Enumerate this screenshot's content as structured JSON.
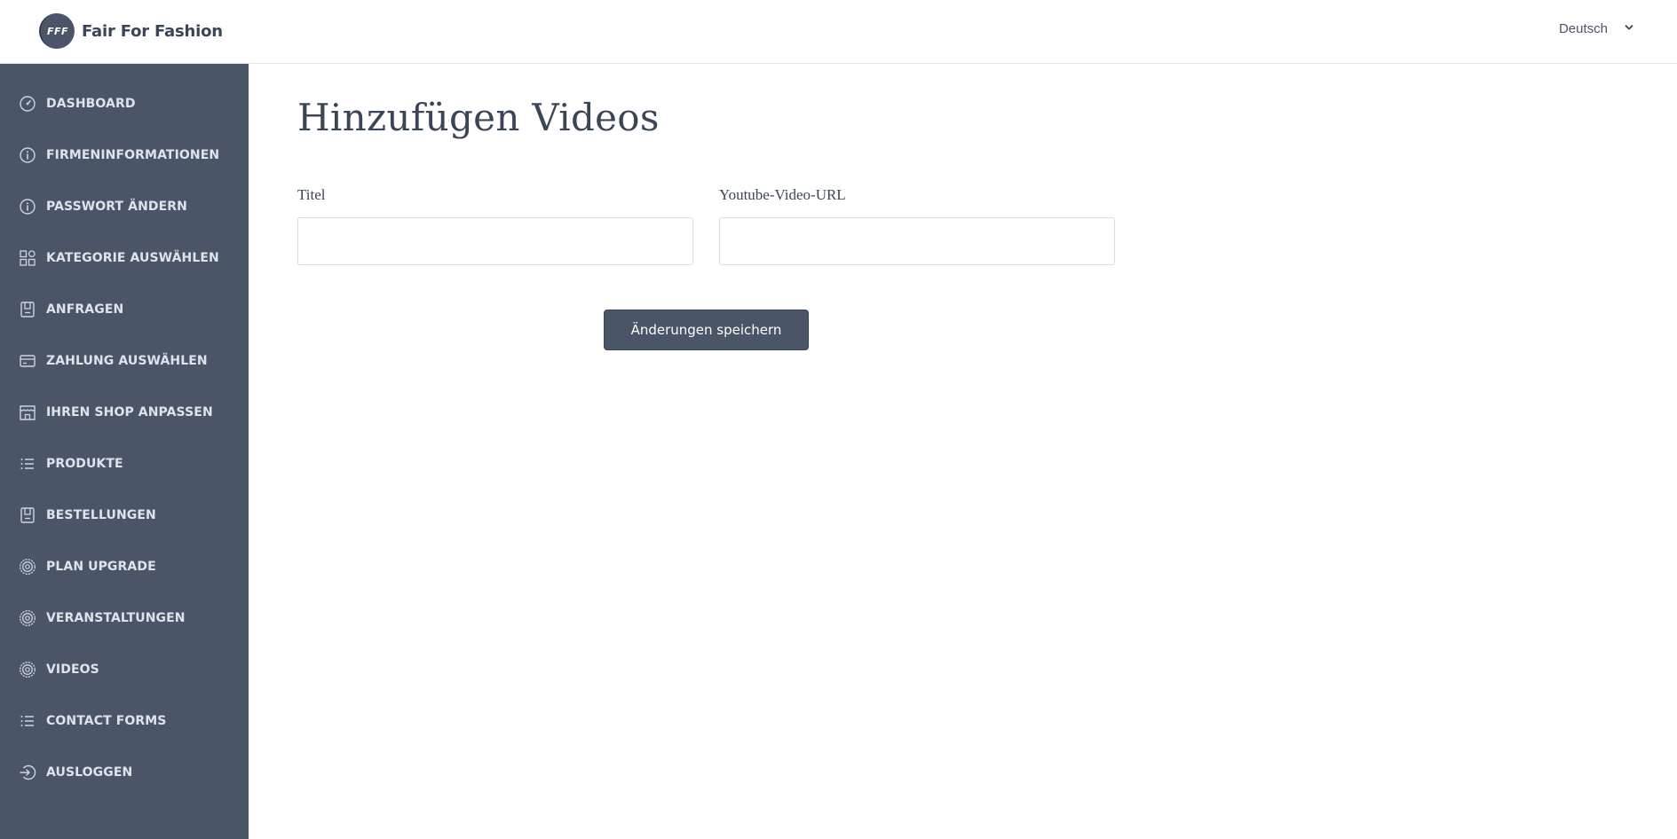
{
  "brand": {
    "logo_mark": "FFF",
    "name": "Fair For Fashion",
    "color": "#4a5568"
  },
  "header": {
    "language": "Deutsch",
    "language_icon": "chevron-down-icon"
  },
  "sidebar": {
    "background": "#4a5568",
    "items": [
      {
        "label": "DASHBOARD",
        "icon": "speedometer-icon"
      },
      {
        "label": "FIRMENINFORMATIONEN",
        "icon": "info-circle-icon"
      },
      {
        "label": "PASSWORT ÄNDERN",
        "icon": "info-circle-icon"
      },
      {
        "label": "KATEGORIE AUSWÄHLEN",
        "icon": "grid-icon"
      },
      {
        "label": "ANFRAGEN",
        "icon": "receipt-icon"
      },
      {
        "label": "ZAHLUNG AUSWÄHLEN",
        "icon": "credit-card-icon"
      },
      {
        "label": "IHREN SHOP ANPASSEN",
        "icon": "shop-icon"
      },
      {
        "label": "PRODUKTE",
        "icon": "list-icon"
      },
      {
        "label": "BESTELLUNGEN",
        "icon": "receipt-icon"
      },
      {
        "label": "PLAN UPGRADE",
        "icon": "gear-icon"
      },
      {
        "label": "VERANSTALTUNGEN",
        "icon": "gear-icon"
      },
      {
        "label": "VIDEOS",
        "icon": "gear-icon"
      },
      {
        "label": "CONTACT FORMS",
        "icon": "list-icon"
      },
      {
        "label": "AUSLOGGEN",
        "icon": "logout-icon"
      }
    ]
  },
  "main": {
    "title": "Hinzufügen Videos",
    "fields": {
      "title": {
        "label": "Titel",
        "value": "",
        "placeholder": ""
      },
      "youtube_url": {
        "label": "Youtube-Video-URL",
        "value": "",
        "placeholder": ""
      }
    },
    "save_label": "Änderungen speichern"
  }
}
